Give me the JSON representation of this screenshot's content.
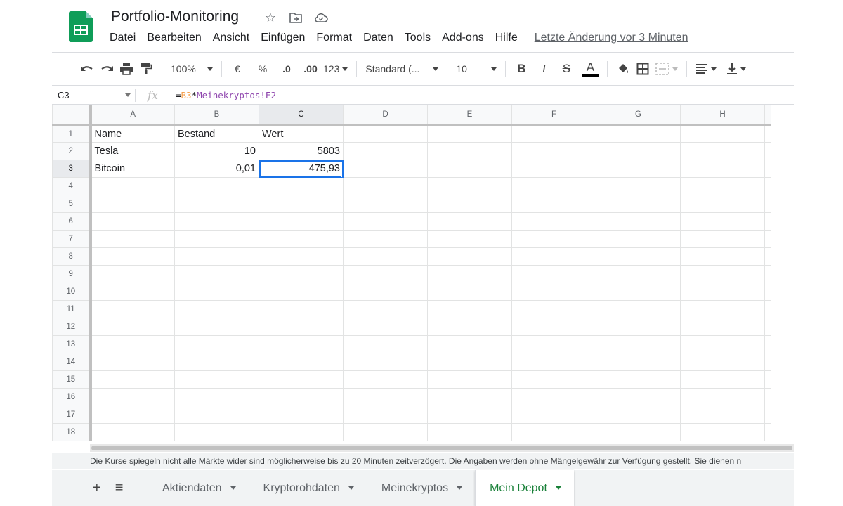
{
  "app": {
    "title": "Portfolio-Monitoring",
    "brand_color": "#0f9d58"
  },
  "menu": {
    "items": [
      "Datei",
      "Bearbeiten",
      "Ansicht",
      "Einfügen",
      "Format",
      "Daten",
      "Tools",
      "Add-ons",
      "Hilfe"
    ],
    "last_change": "Letzte Änderung vor 3 Minuten"
  },
  "toolbar": {
    "zoom": "100%",
    "currency": "€",
    "percent": "%",
    "decrease_decimals": ".0",
    "increase_decimals": ".00",
    "more_formats": "123",
    "font": "Standard (...",
    "font_size": "10",
    "bold": "B",
    "italic": "I",
    "strike": "S",
    "text_color": "A"
  },
  "formula_bar": {
    "cell_ref": "C3",
    "fx": "fx",
    "prefix": "=",
    "ref": "B3",
    "op": "*",
    "sheet_ref": "Meinekryptos!E2"
  },
  "grid": {
    "columns": [
      "A",
      "B",
      "C",
      "D",
      "E",
      "F",
      "G",
      "H"
    ],
    "selected_column": "C",
    "selected_row": 3,
    "rows": [
      [
        "Name",
        "Bestand",
        "Wert",
        "",
        "",
        "",
        "",
        ""
      ],
      [
        "Tesla",
        "10",
        "5803",
        "",
        "",
        "",
        "",
        ""
      ],
      [
        "Bitcoin",
        "0,01",
        "475,93",
        "",
        "",
        "",
        "",
        ""
      ],
      [
        "",
        "",
        "",
        "",
        "",
        "",
        "",
        ""
      ],
      [
        "",
        "",
        "",
        "",
        "",
        "",
        "",
        ""
      ],
      [
        "",
        "",
        "",
        "",
        "",
        "",
        "",
        ""
      ],
      [
        "",
        "",
        "",
        "",
        "",
        "",
        "",
        ""
      ],
      [
        "",
        "",
        "",
        "",
        "",
        "",
        "",
        ""
      ],
      [
        "",
        "",
        "",
        "",
        "",
        "",
        "",
        ""
      ],
      [
        "",
        "",
        "",
        "",
        "",
        "",
        "",
        ""
      ],
      [
        "",
        "",
        "",
        "",
        "",
        "",
        "",
        ""
      ],
      [
        "",
        "",
        "",
        "",
        "",
        "",
        "",
        ""
      ],
      [
        "",
        "",
        "",
        "",
        "",
        "",
        "",
        ""
      ],
      [
        "",
        "",
        "",
        "",
        "",
        "",
        "",
        ""
      ],
      [
        "",
        "",
        "",
        "",
        "",
        "",
        "",
        ""
      ],
      [
        "",
        "",
        "",
        "",
        "",
        "",
        "",
        ""
      ],
      [
        "",
        "",
        "",
        "",
        "",
        "",
        "",
        ""
      ],
      [
        "",
        "",
        "",
        "",
        "",
        "",
        "",
        ""
      ]
    ],
    "numeric_columns": [
      1,
      2
    ]
  },
  "notice": "Die Kurse spiegeln nicht alle Märkte wider sind möglicherweise bis zu 20 Minuten zeitverzögert. Die Angaben werden ohne Mängelgewähr zur Verfügung gestellt. Sie dienen n",
  "sheet_tabs": {
    "add": "+",
    "all_sheets": "≡",
    "tabs": [
      "Aktiendaten",
      "Kryptorohdaten",
      "Meinekryptos",
      "Mein Depot"
    ],
    "active": "Mein Depot"
  }
}
